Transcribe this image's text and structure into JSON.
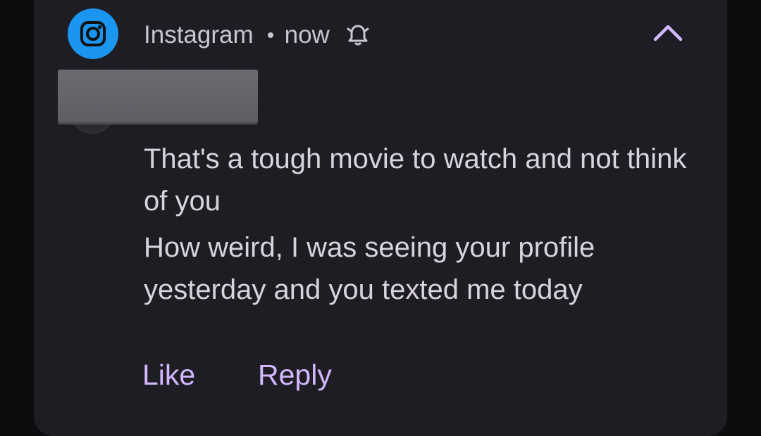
{
  "notification": {
    "app_name": "Instagram",
    "time": "now",
    "app_icon": "instagram-icon",
    "bell_icon": "bell-icon",
    "collapse_icon": "chevron-up-icon",
    "colors": {
      "card_background": "#1f1d24",
      "icon_background": "#1a96f0",
      "action_color": "#d3b8ff",
      "text_color": "#d8d3dc"
    },
    "messages": [
      "That's a tough movie to watch and not think of you",
      "How weird, I was seeing your profile yesterday and you texted me today"
    ],
    "actions": {
      "like": "Like",
      "reply": "Reply"
    }
  }
}
